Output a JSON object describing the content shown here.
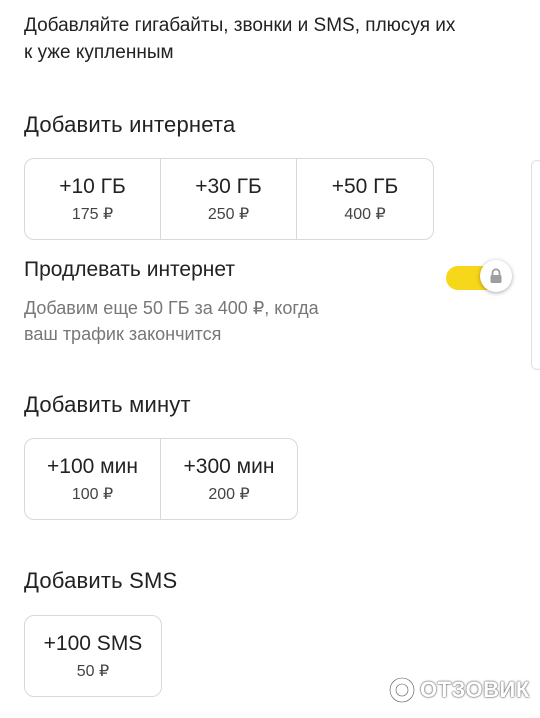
{
  "intro": {
    "line1": "Добавляйте гигабайты, звонки и SMS, плюсуя их",
    "line2": "к уже купленным"
  },
  "internet": {
    "title": "Добавить интернета",
    "options": [
      {
        "amount": "+10 ГБ",
        "price": "175 ₽"
      },
      {
        "amount": "+30 ГБ",
        "price": "250 ₽"
      },
      {
        "amount": "+50 ГБ",
        "price": "400 ₽"
      }
    ]
  },
  "renew": {
    "title": "Продлевать интернет",
    "line1": "Добавим еще 50 ГБ за 400 ₽, когда",
    "line2": "ваш трафик закончится",
    "toggle_on": true,
    "toggle_locked": true,
    "accent": "#f7d71a"
  },
  "minutes": {
    "title": "Добавить минут",
    "options": [
      {
        "amount": "+100 мин",
        "price": "100 ₽"
      },
      {
        "amount": "+300 мин",
        "price": "200 ₽"
      }
    ]
  },
  "sms": {
    "title": "Добавить SMS",
    "options": [
      {
        "amount": "+100 SMS",
        "price": "50 ₽"
      }
    ]
  },
  "watermark": {
    "text": "ОТЗОВИК"
  }
}
